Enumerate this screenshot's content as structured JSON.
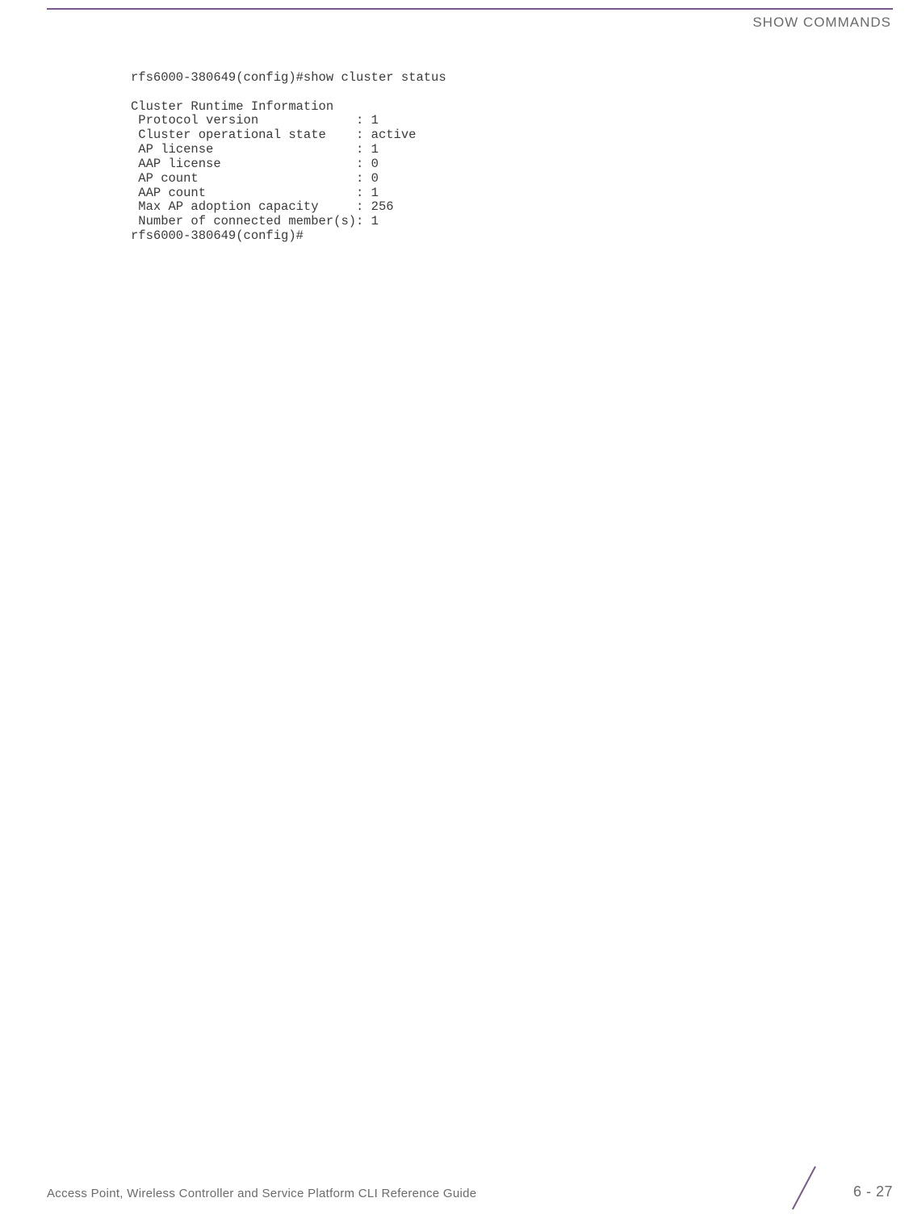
{
  "header": {
    "section_title": "SHOW COMMANDS"
  },
  "cli": {
    "prompt1": "rfs6000-380649(config)#show cluster status",
    "blank1": "",
    "heading": "Cluster Runtime Information",
    "rows": [
      {
        "label": " Protocol version             ",
        "value": "1"
      },
      {
        "label": " Cluster operational state    ",
        "value": "active"
      },
      {
        "label": " AP license                   ",
        "value": "1"
      },
      {
        "label": " AAP license                  ",
        "value": "0"
      },
      {
        "label": " AP count                     ",
        "value": "0"
      },
      {
        "label": " AAP count                    ",
        "value": "1"
      },
      {
        "label": " Max AP adoption capacity     ",
        "value": "256"
      },
      {
        "label": " Number of connected member(s)",
        "value": "1"
      }
    ],
    "prompt2": "rfs6000-380649(config)#"
  },
  "footer": {
    "doc_title": "Access Point, Wireless Controller and Service Platform CLI Reference Guide",
    "page_number": "6 - 27"
  }
}
